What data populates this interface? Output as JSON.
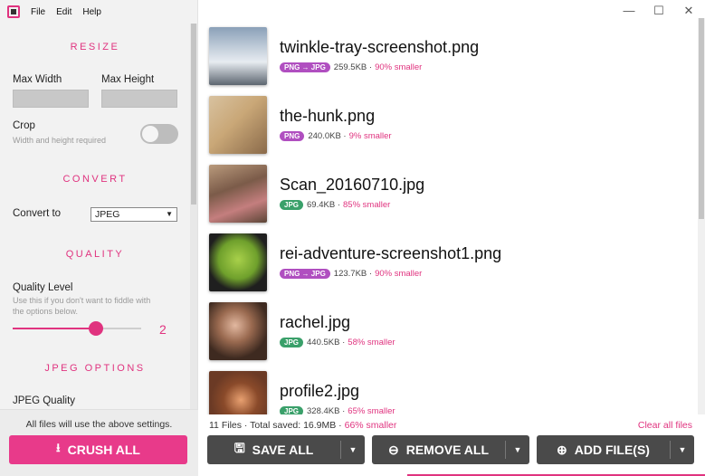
{
  "menu": {
    "file": "File",
    "edit": "Edit",
    "help": "Help"
  },
  "window": {
    "minimize": "—",
    "maximize": "☐",
    "close": "✕"
  },
  "sidebar": {
    "resize_title": "RESIZE",
    "max_width_label": "Max Width",
    "max_height_label": "Max Height",
    "crop_label": "Crop",
    "crop_hint": "Width and height required",
    "crop_enabled": false,
    "convert_title": "CONVERT",
    "convert_to_label": "Convert to",
    "convert_to_value": "JPEG",
    "quality_title": "QUALITY",
    "quality_level_label": "Quality Level",
    "quality_hint_line1": "Use this if you don't want to fiddle with",
    "quality_hint_line2": "the options below.",
    "quality_level_value": "2",
    "quality_level_fraction": 0.65,
    "jpeg_options_title": "JPEG OPTIONS",
    "jpeg_quality_label": "JPEG Quality",
    "bottom_note": "All files will use the above settings.",
    "crush_all_label": "CRUSH ALL"
  },
  "files": [
    {
      "name": "twinkle-tray-screenshot.png",
      "badge": "PNG → JPG",
      "size": "259.5KB",
      "saving": "90% smaller"
    },
    {
      "name": "the-hunk.png",
      "badge": "PNG",
      "size": "240.0KB",
      "saving": "9% smaller"
    },
    {
      "name": "Scan_20160710.jpg",
      "badge": "JPG",
      "size": "69.4KB",
      "saving": "85% smaller"
    },
    {
      "name": "rei-adventure-screenshot1.png",
      "badge": "PNG → JPG",
      "size": "123.7KB",
      "saving": "90% smaller"
    },
    {
      "name": "rachel.jpg",
      "badge": "JPG",
      "size": "440.5KB",
      "saving": "58% smaller"
    },
    {
      "name": "profile2.jpg",
      "badge": "JPG",
      "size": "328.4KB",
      "saving": "65% smaller"
    }
  ],
  "summary": {
    "text": "11 Files · Total saved: 16.9MB · ",
    "pct": "66% smaller"
  },
  "clear_all": "Clear all files",
  "actions": {
    "save_all": "SAVE ALL",
    "remove_all": "REMOVE ALL",
    "add_files": "ADD FILE(S)"
  },
  "colors": {
    "accent": "#e0337f",
    "button_dark": "#4a4a4a",
    "badge_png": "#b04fc0",
    "badge_jpg": "#3aa06a"
  }
}
